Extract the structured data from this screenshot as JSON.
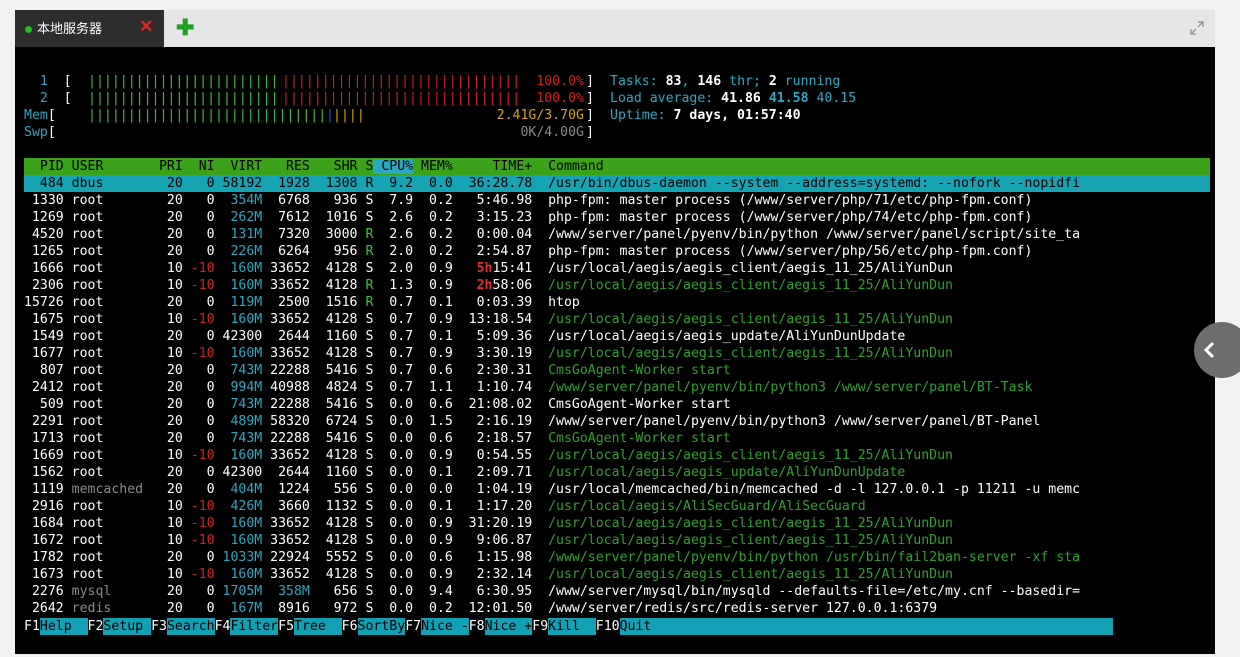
{
  "tab": {
    "label": "本地服务器",
    "close_icon": "✕",
    "add_icon": "✚"
  },
  "meters": [
    {
      "label": "1",
      "value": "100.0%",
      "fill": 1.0
    },
    {
      "label": "2",
      "value": "100.0%",
      "fill": 1.0
    },
    {
      "label": "Mem",
      "value": "2.41G/3.70G",
      "fill": 0.65
    },
    {
      "label": "Swp",
      "value": "0K/4.00G",
      "fill": 0.0
    }
  ],
  "stats": {
    "tasks_label": "Tasks: ",
    "tasks": "83",
    "thr": "146",
    "thr_label": " thr; ",
    "running": "2",
    "running_label": " running",
    "load_label": "Load average: ",
    "load1": "41.86",
    "load5": "41.58",
    "load15": "40.15",
    "uptime_label": "Uptime: ",
    "uptime": "7 days, 01:57:40"
  },
  "columns": [
    "PID",
    "USER",
    "PRI",
    "NI",
    "VIRT",
    "RES",
    "SHR",
    "S",
    "CPU%",
    "MEM%",
    "TIME+",
    "Command"
  ],
  "processes": [
    {
      "pid": "484",
      "user": "dbus",
      "pri": "20",
      "ni": "0",
      "virt": "58192",
      "res": "1928",
      "shr": "1308",
      "s": "R",
      "cpu": "9.2",
      "mem": "0.0",
      "time": "36:28.78",
      "cmd": "/usr/bin/dbus-daemon --system --address=systemd: --nofork --nopidfi",
      "selected": true
    },
    {
      "pid": "1330",
      "user": "root",
      "pri": "20",
      "ni": "0",
      "virt": "354M",
      "res": "6768",
      "shr": "936",
      "s": "S",
      "cpu": "7.9",
      "mem": "0.2",
      "time": "5:46.98",
      "cmd": "php-fpm: master process (/www/server/php/71/etc/php-fpm.conf)"
    },
    {
      "pid": "1269",
      "user": "root",
      "pri": "20",
      "ni": "0",
      "virt": "262M",
      "res": "7612",
      "shr": "1016",
      "s": "S",
      "cpu": "2.6",
      "mem": "0.2",
      "time": "3:15.23",
      "cmd": "php-fpm: master process (/www/server/php/74/etc/php-fpm.conf)"
    },
    {
      "pid": "4520",
      "user": "root",
      "pri": "20",
      "ni": "0",
      "virt": "131M",
      "res": "7320",
      "shr": "3000",
      "s": "R",
      "cpu": "2.6",
      "mem": "0.2",
      "time": "0:00.04",
      "cmd": "/www/server/panel/pyenv/bin/python /www/server/panel/script/site_ta"
    },
    {
      "pid": "1265",
      "user": "root",
      "pri": "20",
      "ni": "0",
      "virt": "226M",
      "res": "6264",
      "shr": "956",
      "s": "R",
      "cpu": "2.0",
      "mem": "0.2",
      "time": "2:54.87",
      "cmd": "php-fpm: master process (/www/server/php/56/etc/php-fpm.conf)"
    },
    {
      "pid": "1666",
      "user": "root",
      "pri": "10",
      "ni": "-10",
      "virt": "160M",
      "res": "33652",
      "shr": "4128",
      "s": "S",
      "cpu": "2.0",
      "mem": "0.9",
      "time": "5h15:41",
      "cmd": "/usr/local/aegis/aegis_client/aegis_11_25/AliYunDun",
      "thread": false
    },
    {
      "pid": "2306",
      "user": "root",
      "pri": "10",
      "ni": "-10",
      "virt": "160M",
      "res": "33652",
      "shr": "4128",
      "s": "R",
      "cpu": "1.3",
      "mem": "0.9",
      "time": "2h58:06",
      "cmd": "/usr/local/aegis/aegis_client/aegis_11_25/AliYunDun",
      "thread": true
    },
    {
      "pid": "15726",
      "user": "root",
      "pri": "20",
      "ni": "0",
      "virt": "119M",
      "res": "2500",
      "shr": "1516",
      "s": "R",
      "cpu": "0.7",
      "mem": "0.1",
      "time": "0:03.39",
      "cmd": "htop"
    },
    {
      "pid": "1675",
      "user": "root",
      "pri": "10",
      "ni": "-10",
      "virt": "160M",
      "res": "33652",
      "shr": "4128",
      "s": "S",
      "cpu": "0.7",
      "mem": "0.9",
      "time": "13:18.54",
      "cmd": "/usr/local/aegis/aegis_client/aegis_11_25/AliYunDun",
      "thread": true
    },
    {
      "pid": "1549",
      "user": "root",
      "pri": "20",
      "ni": "0",
      "virt": "42300",
      "res": "2644",
      "shr": "1160",
      "s": "S",
      "cpu": "0.7",
      "mem": "0.1",
      "time": "5:09.36",
      "cmd": "/usr/local/aegis/aegis_update/AliYunDunUpdate"
    },
    {
      "pid": "1677",
      "user": "root",
      "pri": "10",
      "ni": "-10",
      "virt": "160M",
      "res": "33652",
      "shr": "4128",
      "s": "S",
      "cpu": "0.7",
      "mem": "0.9",
      "time": "3:30.19",
      "cmd": "/usr/local/aegis/aegis_client/aegis_11_25/AliYunDun",
      "thread": true
    },
    {
      "pid": "807",
      "user": "root",
      "pri": "20",
      "ni": "0",
      "virt": "743M",
      "res": "22288",
      "shr": "5416",
      "s": "S",
      "cpu": "0.7",
      "mem": "0.6",
      "time": "2:30.31",
      "cmd": "CmsGoAgent-Worker start",
      "thread": true
    },
    {
      "pid": "2412",
      "user": "root",
      "pri": "20",
      "ni": "0",
      "virt": "994M",
      "res": "40988",
      "shr": "4824",
      "s": "S",
      "cpu": "0.7",
      "mem": "1.1",
      "time": "1:10.74",
      "cmd": "/www/server/panel/pyenv/bin/python3 /www/server/panel/BT-Task",
      "thread": true
    },
    {
      "pid": "509",
      "user": "root",
      "pri": "20",
      "ni": "0",
      "virt": "743M",
      "res": "22288",
      "shr": "5416",
      "s": "S",
      "cpu": "0.0",
      "mem": "0.6",
      "time": "21:08.02",
      "cmd": "CmsGoAgent-Worker start"
    },
    {
      "pid": "2291",
      "user": "root",
      "pri": "20",
      "ni": "0",
      "virt": "489M",
      "res": "58320",
      "shr": "6724",
      "s": "S",
      "cpu": "0.0",
      "mem": "1.5",
      "time": "2:16.19",
      "cmd": "/www/server/panel/pyenv/bin/python3 /www/server/panel/BT-Panel"
    },
    {
      "pid": "1713",
      "user": "root",
      "pri": "20",
      "ni": "0",
      "virt": "743M",
      "res": "22288",
      "shr": "5416",
      "s": "S",
      "cpu": "0.0",
      "mem": "0.6",
      "time": "2:18.57",
      "cmd": "CmsGoAgent-Worker start",
      "thread": true
    },
    {
      "pid": "1669",
      "user": "root",
      "pri": "10",
      "ni": "-10",
      "virt": "160M",
      "res": "33652",
      "shr": "4128",
      "s": "S",
      "cpu": "0.0",
      "mem": "0.9",
      "time": "0:54.55",
      "cmd": "/usr/local/aegis/aegis_client/aegis_11_25/AliYunDun",
      "thread": true
    },
    {
      "pid": "1562",
      "user": "root",
      "pri": "20",
      "ni": "0",
      "virt": "42300",
      "res": "2644",
      "shr": "1160",
      "s": "S",
      "cpu": "0.0",
      "mem": "0.1",
      "time": "2:09.71",
      "cmd": "/usr/local/aegis/aegis_update/AliYunDunUpdate",
      "thread": true
    },
    {
      "pid": "1119",
      "user": "memcached",
      "pri": "20",
      "ni": "0",
      "virt": "404M",
      "res": "1224",
      "shr": "556",
      "s": "S",
      "cpu": "0.0",
      "mem": "0.0",
      "time": "1:04.19",
      "cmd": "/usr/local/memcached/bin/memcached -d -l 127.0.0.1 -p 11211 -u memc"
    },
    {
      "pid": "2916",
      "user": "root",
      "pri": "10",
      "ni": "-10",
      "virt": "426M",
      "res": "3660",
      "shr": "1132",
      "s": "S",
      "cpu": "0.0",
      "mem": "0.1",
      "time": "1:17.20",
      "cmd": "/usr/local/aegis/AliSecGuard/AliSecGuard",
      "thread": true
    },
    {
      "pid": "1684",
      "user": "root",
      "pri": "10",
      "ni": "-10",
      "virt": "160M",
      "res": "33652",
      "shr": "4128",
      "s": "S",
      "cpu": "0.0",
      "mem": "0.9",
      "time": "31:20.19",
      "cmd": "/usr/local/aegis/aegis_client/aegis_11_25/AliYunDun",
      "thread": true
    },
    {
      "pid": "1672",
      "user": "root",
      "pri": "10",
      "ni": "-10",
      "virt": "160M",
      "res": "33652",
      "shr": "4128",
      "s": "S",
      "cpu": "0.0",
      "mem": "0.9",
      "time": "9:06.87",
      "cmd": "/usr/local/aegis/aegis_client/aegis_11_25/AliYunDun",
      "thread": true
    },
    {
      "pid": "1782",
      "user": "root",
      "pri": "20",
      "ni": "0",
      "virt": "1033M",
      "res": "22924",
      "shr": "5552",
      "s": "S",
      "cpu": "0.0",
      "mem": "0.6",
      "time": "1:15.98",
      "cmd": "/www/server/panel/pyenv/bin/python /usr/bin/fail2ban-server -xf sta",
      "thread": true
    },
    {
      "pid": "1673",
      "user": "root",
      "pri": "10",
      "ni": "-10",
      "virt": "160M",
      "res": "33652",
      "shr": "4128",
      "s": "S",
      "cpu": "0.0",
      "mem": "0.9",
      "time": "2:32.14",
      "cmd": "/usr/local/aegis/aegis_client/aegis_11_25/AliYunDun",
      "thread": true
    },
    {
      "pid": "2276",
      "user": "mysql",
      "pri": "20",
      "ni": "0",
      "virt": "1705M",
      "res": "358M",
      "shr": "656",
      "s": "S",
      "cpu": "0.0",
      "mem": "9.4",
      "time": "6:30.95",
      "cmd": "/www/server/mysql/bin/mysqld --defaults-file=/etc/my.cnf --basedir="
    },
    {
      "pid": "2642",
      "user": "redis",
      "pri": "20",
      "ni": "0",
      "virt": "167M",
      "res": "8916",
      "shr": "972",
      "s": "S",
      "cpu": "0.0",
      "mem": "0.2",
      "time": "12:01.50",
      "cmd": "/www/server/redis/src/redis-server 127.0.0.1:6379"
    }
  ],
  "function_keys": [
    {
      "key": "F1",
      "label": "Help  "
    },
    {
      "key": "F2",
      "label": "Setup "
    },
    {
      "key": "F3",
      "label": "Search"
    },
    {
      "key": "F4",
      "label": "Filter"
    },
    {
      "key": "F5",
      "label": "Tree  "
    },
    {
      "key": "F6",
      "label": "SortBy"
    },
    {
      "key": "F7",
      "label": "Nice -"
    },
    {
      "key": "F8",
      "label": "Nice +"
    },
    {
      "key": "F9",
      "label": "Kill  "
    },
    {
      "key": "F10",
      "label": "Quit"
    }
  ],
  "colors": {
    "terminal_bg": "#000000",
    "header_bg": "#3ca21a",
    "selected_bg": "#16a3b3",
    "cyan": "#2aa9c2",
    "green": "#3ac23a",
    "red": "#d02020"
  }
}
